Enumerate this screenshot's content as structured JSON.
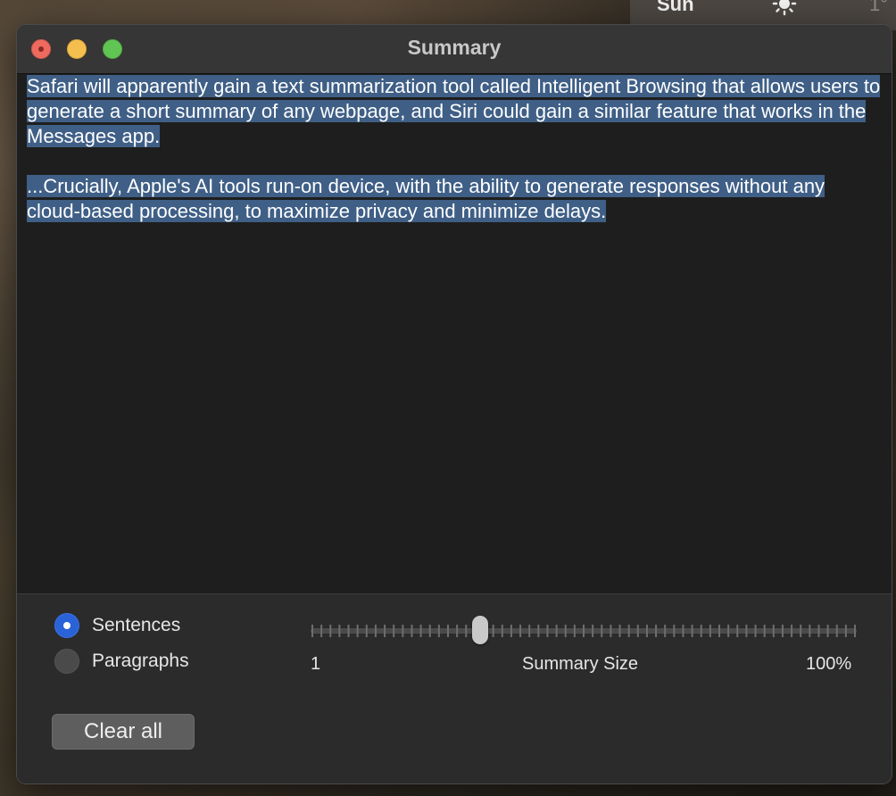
{
  "desktop_widget": {
    "day": "Sun",
    "temperature": "1°",
    "icon": "sun-icon"
  },
  "window": {
    "title": "Summary"
  },
  "summary_text": {
    "paragraph_1": "Safari will apparently gain a text summarization tool called Intelligent Browsing that allows users to generate a short summary of any webpage, and Siri could gain a similar feature that works in the Messages app.",
    "paragraph_2": "...Crucially, Apple's AI tools run-on device, with the ability to generate responses without any cloud-based processing, to maximize privacy and minimize delays.",
    "selection_color": "#3f5f86"
  },
  "controls": {
    "mode_options": [
      {
        "label": "Sentences",
        "selected": true
      },
      {
        "label": "Paragraphs",
        "selected": false
      }
    ],
    "summary_size": {
      "label": "Summary Size",
      "min_label": "1",
      "max_label": "100%",
      "value_fraction": 0.31
    },
    "clear_button": "Clear all"
  },
  "colors": {
    "close": "#ed6a5e",
    "minimize": "#f5bf4f",
    "maximize": "#61c554",
    "radio_selected": "#2a62d8"
  }
}
